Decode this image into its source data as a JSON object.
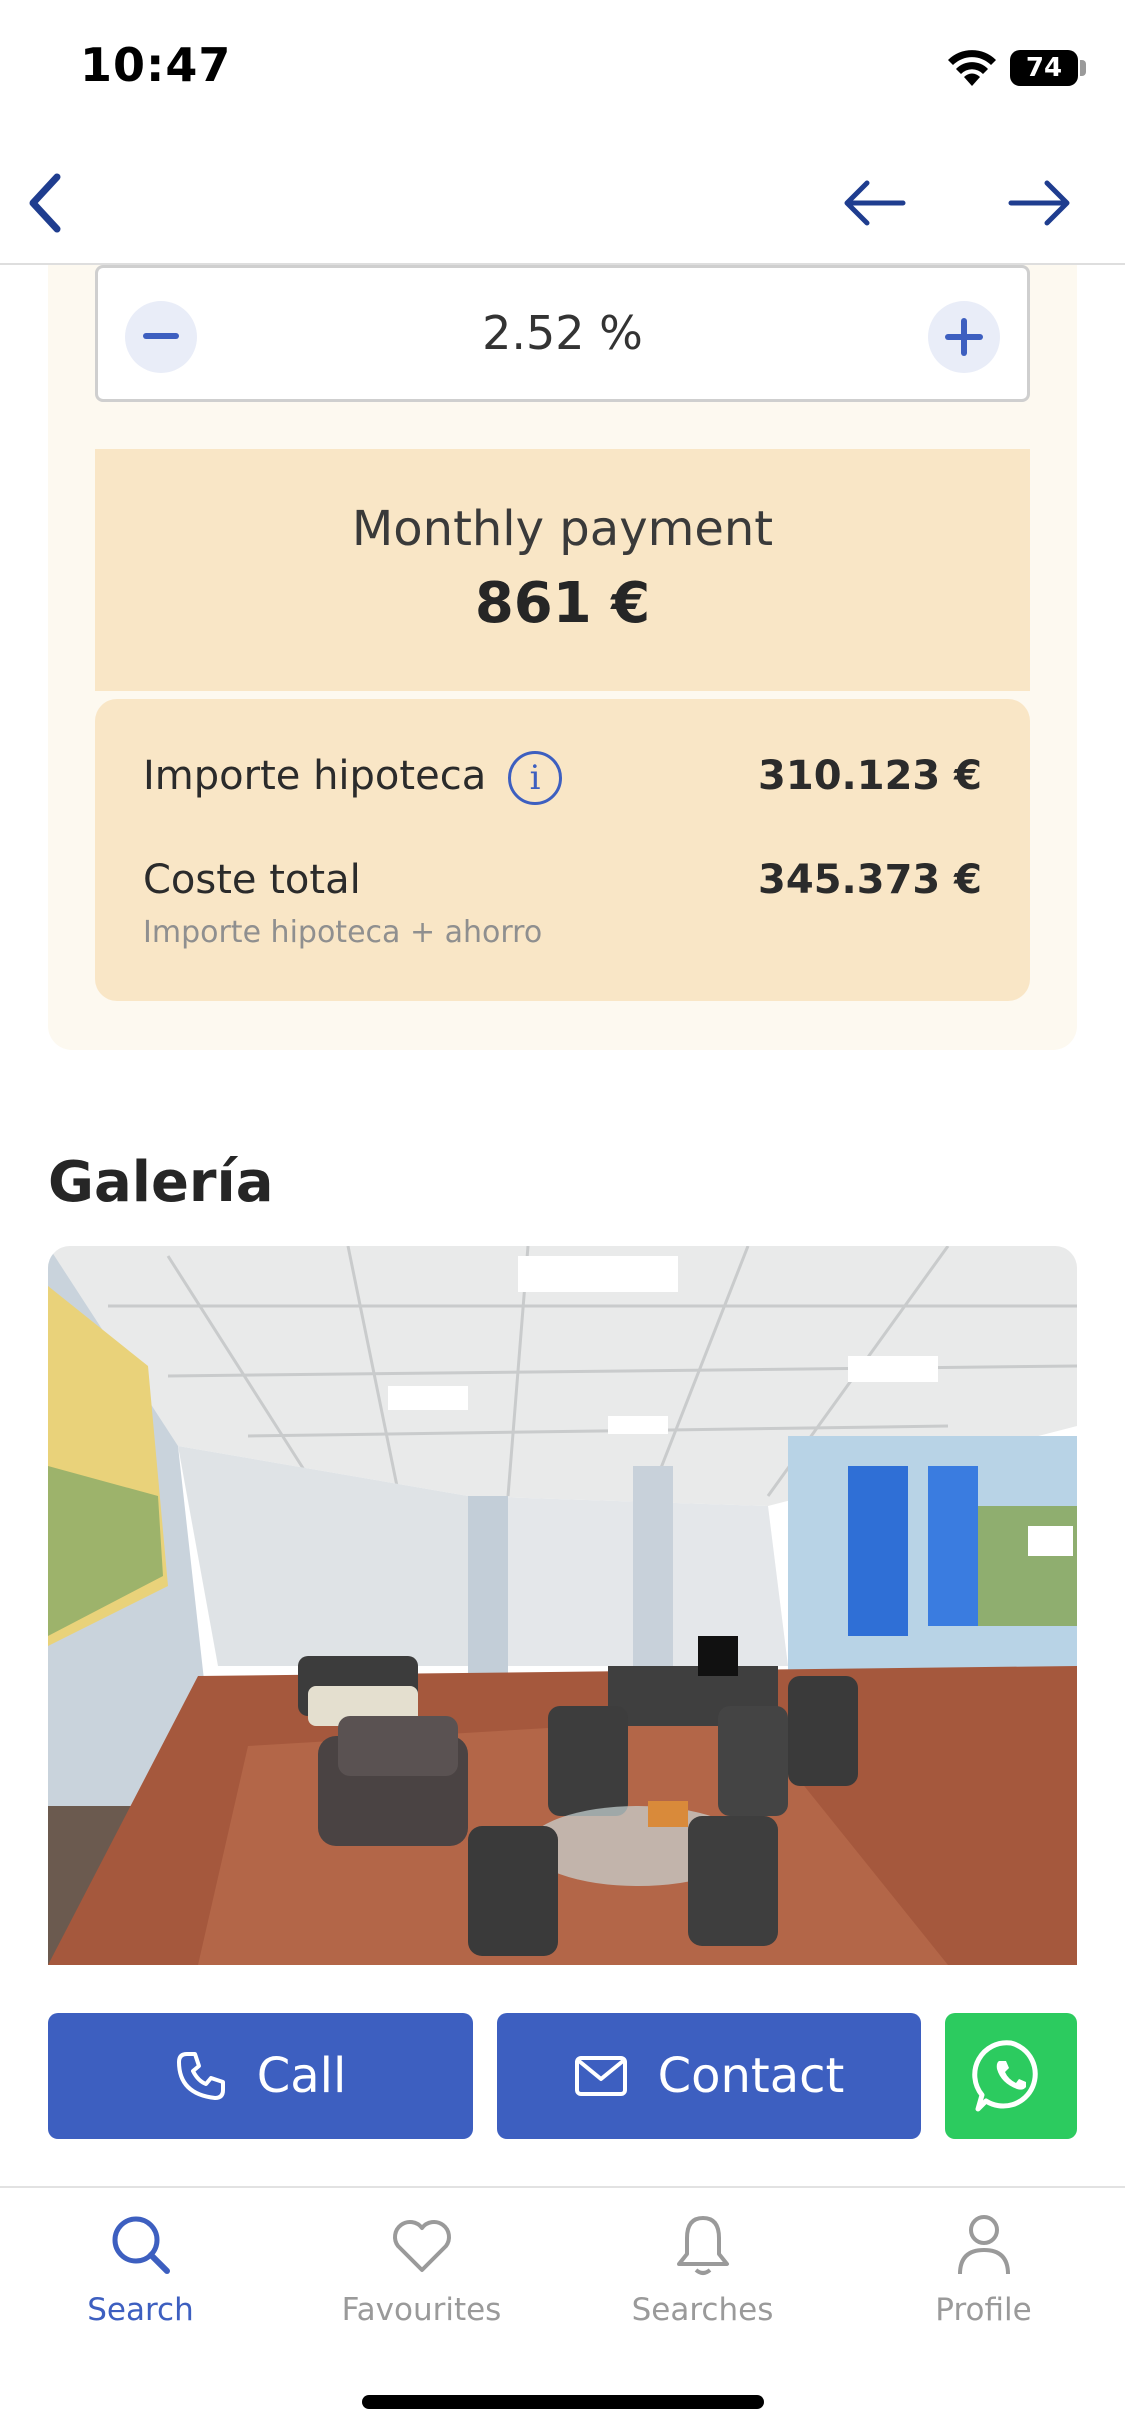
{
  "status_bar": {
    "time": "10:47",
    "battery": "74"
  },
  "calculator": {
    "interest_rate": "2.52 %",
    "monthly_payment_label": "Monthly payment",
    "monthly_payment_value": "861 €",
    "mortgage_amount_label": "Importe hipoteca",
    "mortgage_amount_value": "310.123 €",
    "total_cost_label": "Coste total",
    "total_cost_value": "345.373 €",
    "total_cost_note": "Importe hipoteca + ahorro"
  },
  "gallery": {
    "title": "Galería"
  },
  "actions": {
    "call_label": "Call",
    "contact_label": "Contact"
  },
  "tab_bar": {
    "items": [
      {
        "label": "Search",
        "icon": "search-icon",
        "active": true
      },
      {
        "label": "Favourites",
        "icon": "heart-icon",
        "active": false
      },
      {
        "label": "Searches",
        "icon": "bell-icon",
        "active": false
      },
      {
        "label": "Profile",
        "icon": "person-icon",
        "active": false
      }
    ]
  },
  "colors": {
    "accent": "#3d5fc0",
    "whatsapp": "#2ccb5f",
    "calc_background": "#fdf9f0",
    "payment_background": "#f9e6c6",
    "nav_icon": "#1f3d8f"
  }
}
